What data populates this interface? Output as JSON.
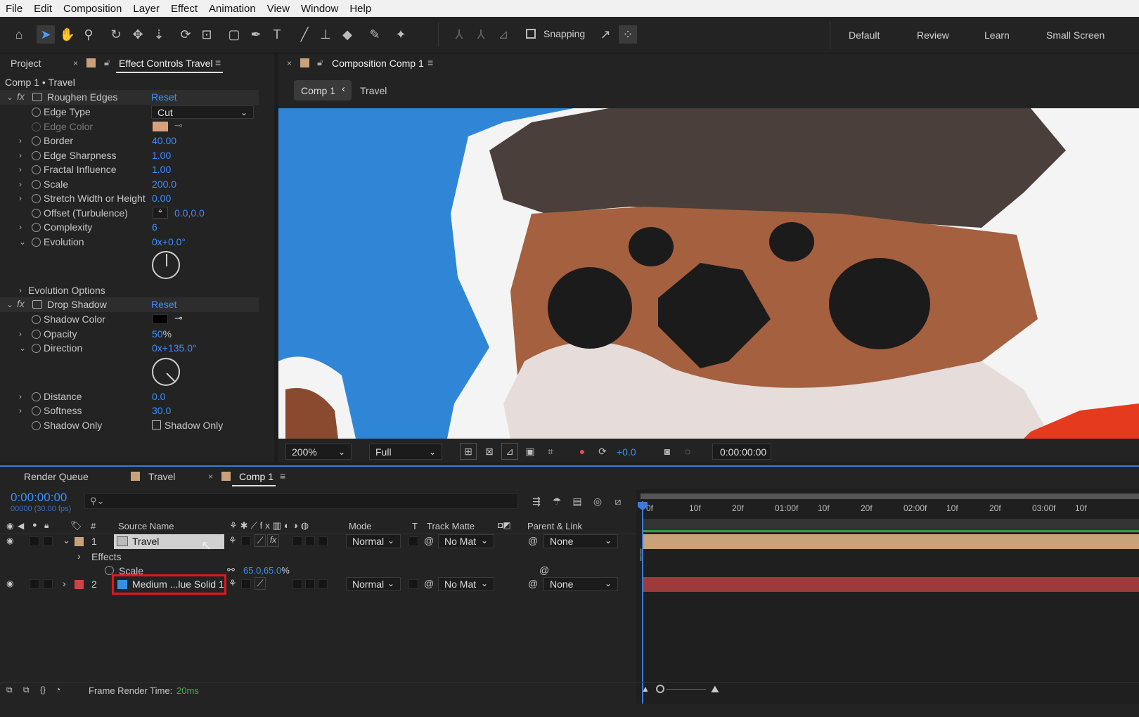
{
  "menu": [
    "File",
    "Edit",
    "Composition",
    "Layer",
    "Effect",
    "Animation",
    "View",
    "Window",
    "Help"
  ],
  "toolbar": {
    "snapping_label": "Snapping",
    "workspaces": [
      "Default",
      "Review",
      "Learn",
      "Small Screen"
    ]
  },
  "left_panel": {
    "tab_project": "Project",
    "tab_effect_controls": "Effect Controls Travel",
    "breadcrumb": "Comp 1 • Travel",
    "roughen": {
      "name": "Roughen Edges",
      "reset": "Reset",
      "props": [
        {
          "label": "Edge Type",
          "value": "Cut"
        },
        {
          "label": "Edge Color",
          "value": ""
        },
        {
          "label": "Border",
          "value": "40.00"
        },
        {
          "label": "Edge Sharpness",
          "value": "1.00"
        },
        {
          "label": "Fractal Influence",
          "value": "1.00"
        },
        {
          "label": "Scale",
          "value": "200.0"
        },
        {
          "label": "Stretch Width or Height",
          "value": "0.00"
        },
        {
          "label": "Offset (Turbulence)",
          "value": "0.0,0.0"
        },
        {
          "label": "Complexity",
          "value": "6"
        },
        {
          "label": "Evolution",
          "value": "0x+0.0°"
        }
      ],
      "evolution_options": "Evolution Options"
    },
    "shadow": {
      "name": "Drop Shadow",
      "reset": "Reset",
      "shadow_color": "Shadow Color",
      "opacity_label": "Opacity",
      "opacity_value": "50",
      "opacity_unit": "%",
      "direction_label": "Direction",
      "direction_value": "0x+135.0°",
      "distance_label": "Distance",
      "distance_value": "0.0",
      "softness_label": "Softness",
      "softness_value": "30.0",
      "shadow_only_label": "Shadow Only",
      "shadow_only_check": "Shadow Only"
    },
    "edge_color": "#d9a07a",
    "shadow_color": "#000000"
  },
  "comp_panel": {
    "tab": "Composition Comp 1",
    "crumb1": "Comp 1",
    "crumb2": "Travel",
    "zoom": "200%",
    "resolution": "Full",
    "exposure": "+0.0",
    "timecode": "0:00:00:00"
  },
  "timeline": {
    "tabs": [
      "Render Queue",
      "Travel",
      "Comp 1"
    ],
    "timecode": "0:00:00:00",
    "fps": "00000 (30.00 fps)",
    "search_placeholder": "",
    "headers": {
      "source": "Source Name",
      "mode": "Mode",
      "t": "T",
      "matte": "Track Matte",
      "parent": "Parent & Link"
    },
    "ruler": [
      "0f",
      "10f",
      "20f",
      "01:00f",
      "10f",
      "20f",
      "02:00f",
      "10f",
      "20f",
      "03:00f",
      "10f"
    ],
    "layers": [
      {
        "num": "1",
        "name": "Travel",
        "mode": "Normal",
        "matte": "No Mat",
        "parent": "None",
        "color": "#c9a27a"
      },
      {
        "num": "2",
        "name": "Medium ...lue Solid 1",
        "mode": "Normal",
        "matte": "No Mat",
        "parent": "None",
        "color": "#c84646"
      }
    ],
    "effects_label": "Effects",
    "scale_label": "Scale",
    "scale_value": "65.0,65.0",
    "scale_unit": "%",
    "status_label": "Frame Render Time:",
    "status_value": "20ms"
  }
}
